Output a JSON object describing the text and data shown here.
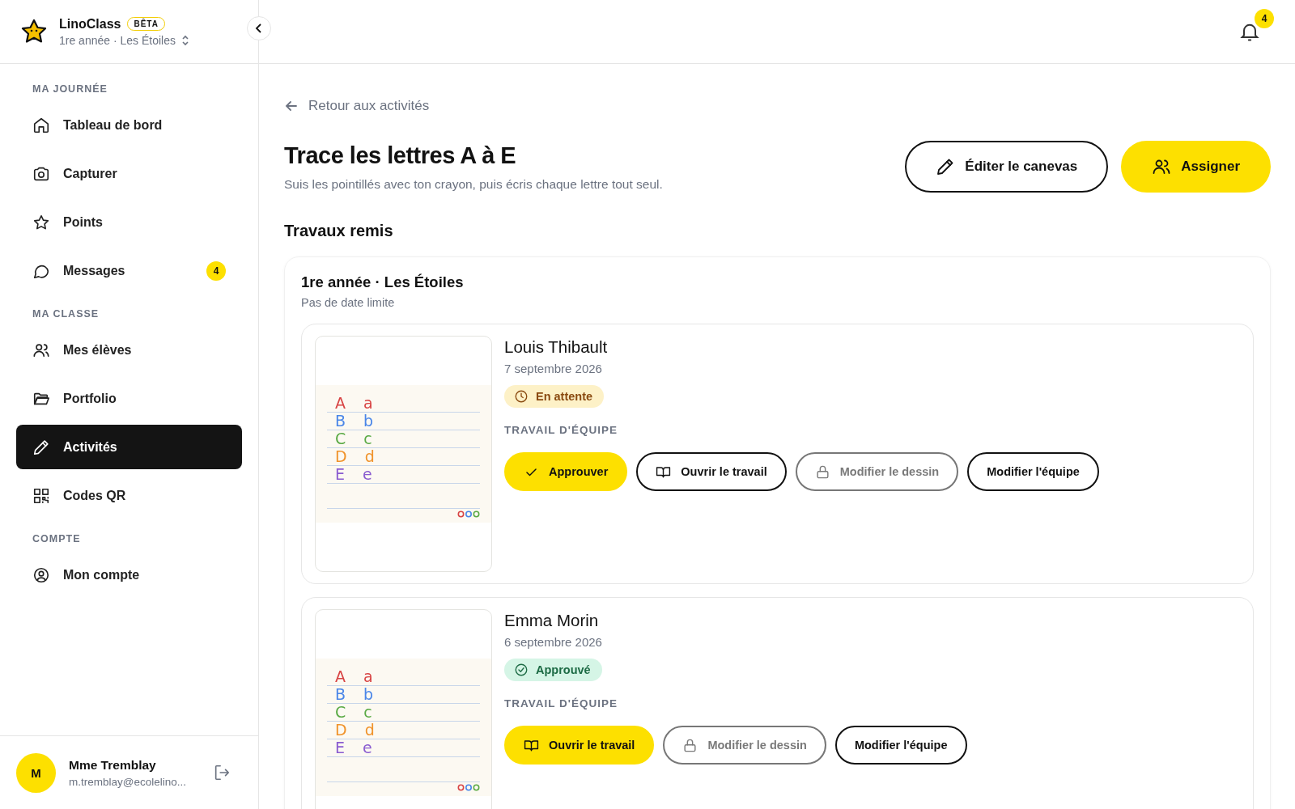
{
  "brand": {
    "name": "LinoClass",
    "badge": "BÊTA",
    "class_switcher": "1re année · Les Étoiles"
  },
  "notifications": {
    "count": "4"
  },
  "sidebar": {
    "sections": [
      {
        "title": "MA JOURNÉE",
        "items": [
          {
            "label": "Tableau de bord",
            "selected": false
          },
          {
            "label": "Capturer",
            "selected": false
          },
          {
            "label": "Points",
            "selected": false
          },
          {
            "label": "Messages",
            "selected": false,
            "badge": "4"
          }
        ]
      },
      {
        "title": "MA CLASSE",
        "items": [
          {
            "label": "Mes élèves",
            "selected": false
          },
          {
            "label": "Portfolio",
            "selected": false
          },
          {
            "label": "Activités",
            "selected": true
          },
          {
            "label": "Codes QR",
            "selected": false
          }
        ]
      },
      {
        "title": "COMPTE",
        "items": [
          {
            "label": "Mon compte",
            "selected": false
          }
        ]
      }
    ]
  },
  "user": {
    "initial": "M",
    "name": "Mme Tremblay",
    "email": "m.tremblay@ecolelino..."
  },
  "back_link": "Retour aux activités",
  "title": "Trace les lettres A à E",
  "subtitle": "Suis les pointillés avec ton crayon, puis écris chaque lettre tout seul.",
  "header_buttons": [
    {
      "label": "Éditer le canevas",
      "kind": "outline"
    },
    {
      "label": "Assigner",
      "kind": "primary"
    }
  ],
  "section_title": "Travaux remis",
  "group": {
    "title": "1re année · Les Étoiles",
    "due": "Pas de date limite",
    "submissions": [
      {
        "name": "Louis Thibault",
        "date": "7 septembre 2026",
        "status": {
          "kind": "pending",
          "label": "En attente"
        },
        "team_label": "TRAVAIL D'ÉQUIPE",
        "thumbnail": {
          "rows": [
            {
              "upper": "A",
              "lower": "a",
              "color": "#d84545"
            },
            {
              "upper": "B",
              "lower": "b",
              "color": "#4a86e8"
            },
            {
              "upper": "C",
              "lower": "c",
              "color": "#5aaa45"
            },
            {
              "upper": "D",
              "lower": "d",
              "color": "#f0932b"
            },
            {
              "upper": "E",
              "lower": "e",
              "color": "#8a5cd0"
            }
          ]
        },
        "actions": [
          {
            "label": "Approuver",
            "kind": "approve",
            "disabled": false
          },
          {
            "label": "Ouvrir le travail",
            "kind": "open",
            "disabled": false
          },
          {
            "label": "Modifier le dessin",
            "kind": "edit-drawing",
            "disabled": true
          },
          {
            "label": "Modifier l'équipe",
            "kind": "edit-team",
            "disabled": false
          }
        ]
      },
      {
        "name": "Emma Morin",
        "date": "6 septembre 2026",
        "status": {
          "kind": "approved",
          "label": "Approuvé"
        },
        "team_label": "TRAVAIL D'ÉQUIPE",
        "thumbnail": {
          "rows": [
            {
              "upper": "A",
              "lower": "a",
              "color": "#d84545"
            },
            {
              "upper": "B",
              "lower": "b",
              "color": "#4a86e8"
            },
            {
              "upper": "C",
              "lower": "c",
              "color": "#5aaa45"
            },
            {
              "upper": "D",
              "lower": "d",
              "color": "#f0932b"
            },
            {
              "upper": "E",
              "lower": "e",
              "color": "#8a5cd0"
            }
          ]
        },
        "actions": [
          {
            "label": "Ouvrir le travail",
            "kind": "open-primary",
            "disabled": false
          },
          {
            "label": "Modifier le dessin",
            "kind": "edit-drawing",
            "disabled": true
          },
          {
            "label": "Modifier l'équipe",
            "kind": "edit-team",
            "disabled": false
          }
        ]
      }
    ]
  }
}
